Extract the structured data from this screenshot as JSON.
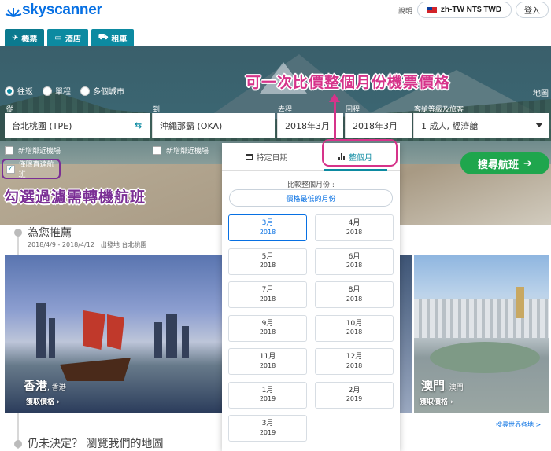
{
  "header": {
    "logo": "skyscanner",
    "help": "說明",
    "locale": "zh-TW NT$ TWD",
    "login": "登入"
  },
  "nav_tabs": [
    {
      "label": "機票",
      "icon": "plane-icon",
      "active": true
    },
    {
      "label": "酒店",
      "icon": "bed-icon",
      "active": false
    },
    {
      "label": "租車",
      "icon": "car-icon",
      "active": false
    }
  ],
  "trip_type": {
    "options": [
      "往返",
      "單程",
      "多個城市"
    ],
    "selected": "往返"
  },
  "map_link": "地圖",
  "search": {
    "from_label": "從",
    "to_label": "到",
    "depart_label": "去程",
    "return_label": "回程",
    "cabin_label": "客艙等級及旅客",
    "from_value": "台北桃園 (TPE)",
    "to_value": "沖繩那霸 (OKA)",
    "depart_value": "2018年3月",
    "return_value": "2018年3月",
    "cabin_value": "1 成人, 經濟艙",
    "nearby_from": "新增鄰近機場",
    "nearby_to": "新增鄰近機場",
    "direct_only": "僅限直達航班",
    "direct_checked": true,
    "search_button": "搜尋航班"
  },
  "annotations": {
    "top": "可一次比價整個月份機票價格",
    "left": "勾選過濾需轉機航班",
    "top_color": "#d6338a",
    "left_color": "#7b2f95"
  },
  "date_picker": {
    "tab_specific": "特定日期",
    "tab_whole_month": "整個月",
    "compare_label": "比較整個月份 :",
    "cheapest_button": "價格最低的月份",
    "months": [
      {
        "m": "3月",
        "y": "2018",
        "selected": true
      },
      {
        "m": "4月",
        "y": "2018"
      },
      {
        "m": "5月",
        "y": "2018"
      },
      {
        "m": "6月",
        "y": "2018"
      },
      {
        "m": "7月",
        "y": "2018"
      },
      {
        "m": "8月",
        "y": "2018"
      },
      {
        "m": "9月",
        "y": "2018"
      },
      {
        "m": "10月",
        "y": "2018"
      },
      {
        "m": "11月",
        "y": "2018"
      },
      {
        "m": "12月",
        "y": "2018"
      },
      {
        "m": "1月",
        "y": "2019"
      },
      {
        "m": "2月",
        "y": "2019"
      },
      {
        "m": "3月",
        "y": "2019"
      }
    ]
  },
  "recommend": {
    "title": "為您推薦",
    "subtitle": "2018/4/9 - 2018/4/12　出發地 台北桃園",
    "cards": [
      {
        "city": "香港",
        "region": "香港",
        "price_link": "獲取價格"
      },
      {
        "city": "澳門",
        "region": "澳門",
        "price_link": "獲取價格"
      }
    ],
    "world_link": "搜尋世界各地 >"
  },
  "undecided": "仍未決定？ 瀏覽我們的地圖",
  "colors": {
    "brand": "#0770e3",
    "tab_teal": "#0c8aa1",
    "search_green": "#1fa64d"
  }
}
